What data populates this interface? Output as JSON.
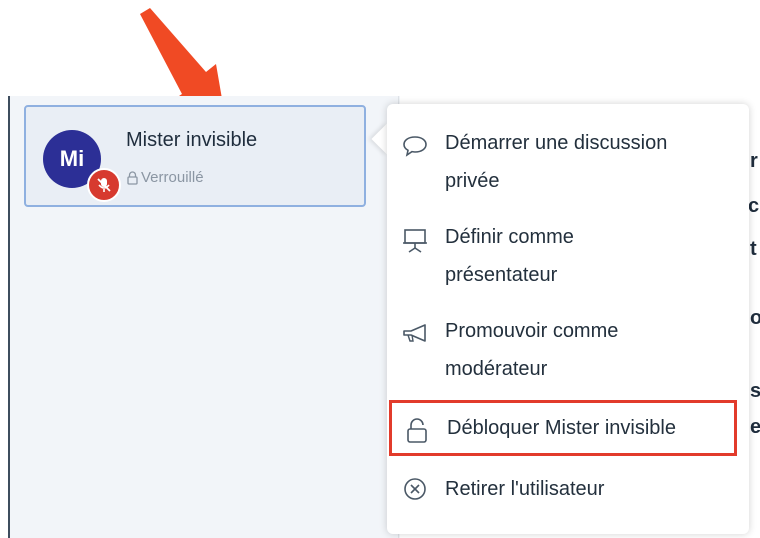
{
  "user_card": {
    "avatar_initials": "Mi",
    "name": "Mister invisible",
    "status": "Verrouillé"
  },
  "menu": {
    "items": [
      {
        "line1": "Démarrer une discussion",
        "line2": "privée",
        "icon": "speech-bubble-icon"
      },
      {
        "line1": "Définir comme",
        "line2": "présentateur",
        "icon": "presentation-screen-icon"
      },
      {
        "line1": "Promouvoir comme",
        "line2": "modérateur",
        "icon": "megaphone-icon"
      },
      {
        "line1": "Débloquer Mister invisible",
        "icon": "unlock-icon",
        "highlighted": true
      },
      {
        "line1": "Retirer l'utilisateur",
        "icon": "close-circle-icon"
      }
    ]
  },
  "edge_text": [
    "r",
    "c",
    "t",
    "o",
    "s",
    "e"
  ],
  "colors": {
    "highlight": "#e23b2b",
    "arrow": "#f04a24",
    "avatar_bg": "#2c2f96",
    "mute_badge": "#d73a2f"
  }
}
